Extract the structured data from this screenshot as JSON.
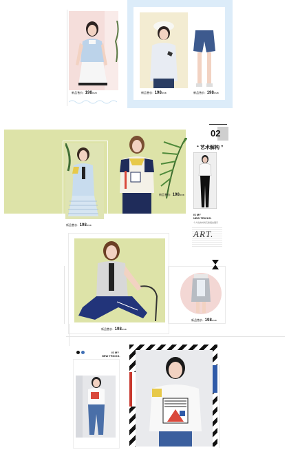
{
  "section_number": "02",
  "section_title": "“ 艺术解构 ”",
  "tagline": {
    "line1": "IS MY",
    "line2": "NEW TRICKS.",
    "small": "个人化的时尚元素组合展示"
  },
  "lower_tagline": {
    "line1": "IS MY",
    "line2": "NEW TRICKS."
  },
  "art_word": "ART.",
  "price_label": "新品售价:",
  "price_value": "198",
  "colors": {
    "accent_blue": "#dcecf9",
    "yellow_green": "#dde3a8",
    "navy": "#1f2c5a",
    "pink": "#f3d7d4"
  },
  "products": [
    {
      "name": "blue-shirt-white-skirt",
      "price": "198"
    },
    {
      "name": "white-shirt-shorts",
      "price": "198"
    },
    {
      "name": "striped-dress",
      "price": "198"
    },
    {
      "name": "color-block-tee",
      "price": "198"
    },
    {
      "name": "vest-navy-pants",
      "price": "198"
    },
    {
      "name": "grey-skirt",
      "price": "198"
    }
  ]
}
